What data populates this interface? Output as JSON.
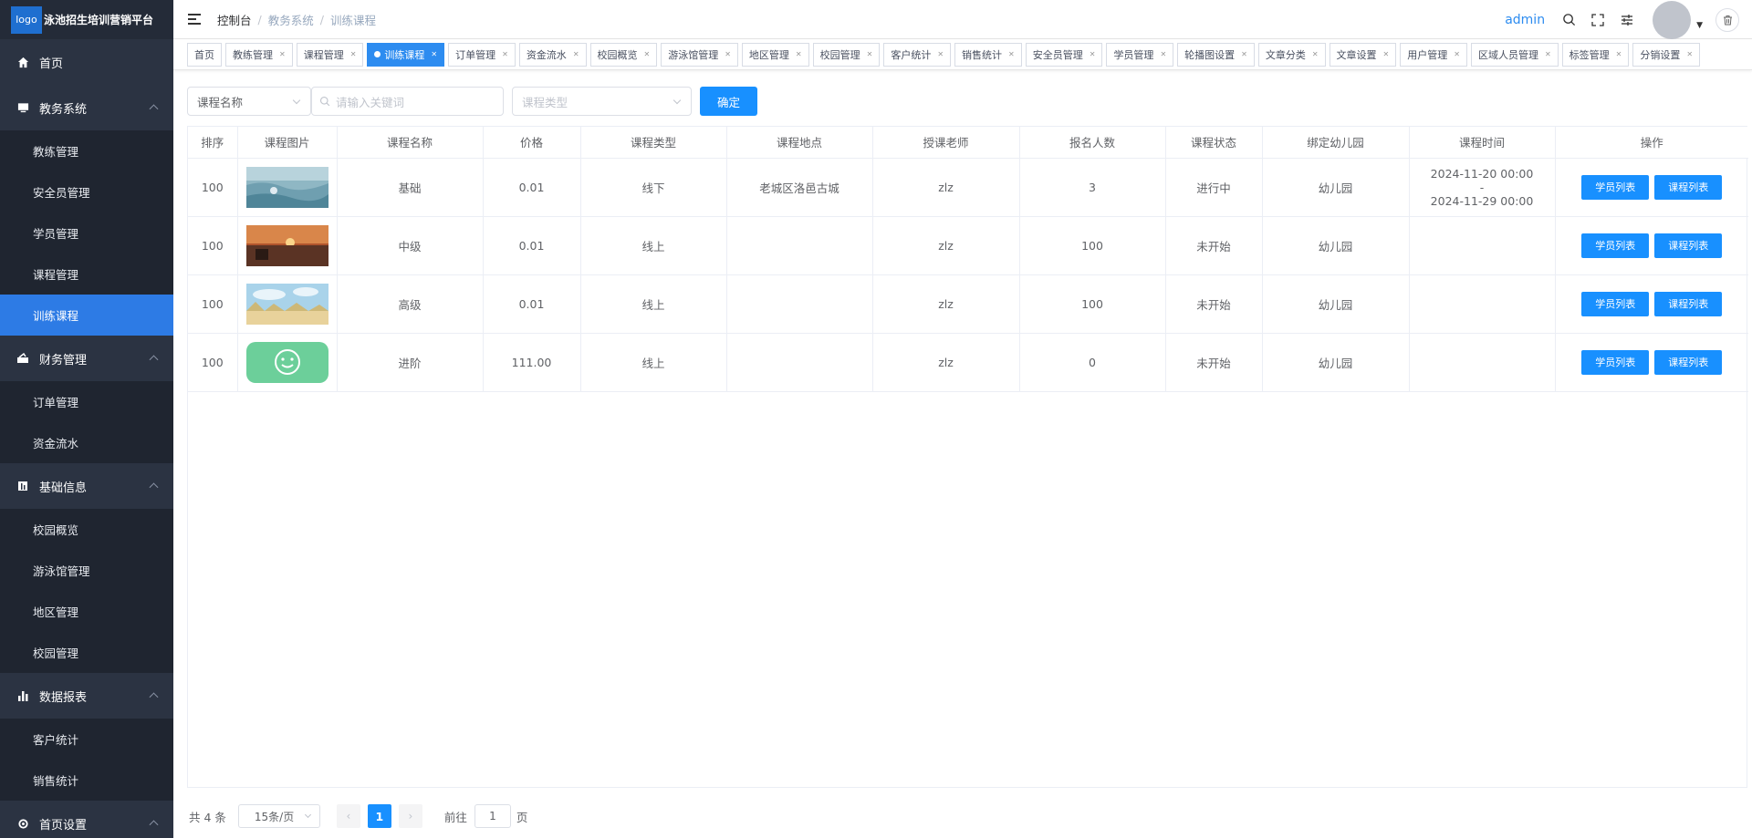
{
  "brand": {
    "logo": "logo",
    "title": "泳池招生培训营销平台"
  },
  "sidebar": {
    "groups": [
      {
        "label": "首页",
        "icon": "home-icon",
        "items": []
      },
      {
        "label": "教务系统",
        "icon": "monitor-icon",
        "items": [
          "教练管理",
          "安全员管理",
          "学员管理",
          "课程管理",
          "训练课程"
        ]
      },
      {
        "label": "财务管理",
        "icon": "finance-icon",
        "items": [
          "订单管理",
          "资金流水"
        ]
      },
      {
        "label": "基础信息",
        "icon": "info-icon",
        "items": [
          "校园概览",
          "游泳馆管理",
          "地区管理",
          "校园管理"
        ]
      },
      {
        "label": "数据报表",
        "icon": "chart-icon",
        "items": [
          "客户统计",
          "销售统计"
        ]
      },
      {
        "label": "首页设置",
        "icon": "settings-icon",
        "items": []
      }
    ],
    "active_item": "训练课程"
  },
  "header": {
    "breadcrumb": [
      "控制台",
      "教务系统",
      "训练课程"
    ],
    "breadcrumb_sep": "/",
    "user": "admin"
  },
  "tags": [
    "首页",
    "教练管理",
    "课程管理",
    "训练课程",
    "订单管理",
    "资金流水",
    "校园概览",
    "游泳馆管理",
    "地区管理",
    "校园管理",
    "客户统计",
    "销售统计",
    "安全员管理",
    "学员管理",
    "轮播图设置",
    "文章分类",
    "文章设置",
    "用户管理",
    "区域人员管理",
    "标签管理",
    "分销设置"
  ],
  "active_tag": "训练课程",
  "filter": {
    "field_select": "课程名称",
    "keyword_placeholder": "请输入关键词",
    "type_placeholder": "课程类型",
    "confirm": "确定"
  },
  "table": {
    "columns": [
      "排序",
      "课程图片",
      "课程名称",
      "价格",
      "课程类型",
      "课程地点",
      "授课老师",
      "报名人数",
      "课程状态",
      "绑定幼儿园",
      "课程时间",
      "操作"
    ],
    "rows": [
      {
        "sort": "100",
        "image": "sea-photo",
        "name": "基础",
        "price": "0.01",
        "type": "线下",
        "location": "老城区洛邑古城",
        "teacher": "zlz",
        "enrolled": "3",
        "status": "进行中",
        "kindergarten": "幼儿园",
        "time_start": "2024-11-20 00:00",
        "time_sep": "-",
        "time_end": "2024-11-29 00:00"
      },
      {
        "sort": "100",
        "image": "sunset-photo",
        "name": "中级",
        "price": "0.01",
        "type": "线上",
        "location": "",
        "teacher": "zlz",
        "enrolled": "100",
        "status": "未开始",
        "kindergarten": "幼儿园",
        "time_start": "",
        "time_sep": "",
        "time_end": ""
      },
      {
        "sort": "100",
        "image": "sky-grass-photo",
        "name": "高级",
        "price": "0.01",
        "type": "线上",
        "location": "",
        "teacher": "zlz",
        "enrolled": "100",
        "status": "未开始",
        "kindergarten": "幼儿园",
        "time_start": "",
        "time_sep": "",
        "time_end": ""
      },
      {
        "sort": "100",
        "image": "smiley-icon",
        "name": "进阶",
        "price": "111.00",
        "type": "线上",
        "location": "",
        "teacher": "zlz",
        "enrolled": "0",
        "status": "未开始",
        "kindergarten": "幼儿园",
        "time_start": "",
        "time_sep": "",
        "time_end": ""
      }
    ],
    "actions": {
      "students": "学员列表",
      "courses": "课程列表"
    }
  },
  "pagination": {
    "total": "共 4 条",
    "page_size": "15条/页",
    "current": "1",
    "goto_label": "前往",
    "goto_value": "1",
    "page_suffix": "页"
  },
  "colors": {
    "sidebar_bg": "#2b3342",
    "primary": "#1890ff",
    "active_menu": "#2d7be5"
  }
}
